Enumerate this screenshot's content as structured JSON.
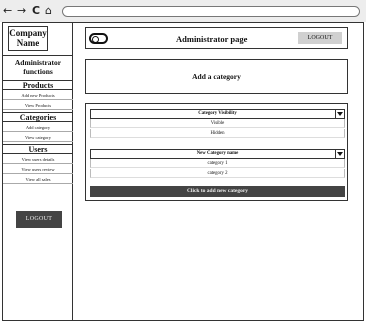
{
  "browser": {
    "back_glyph": "←",
    "forward_glyph": "→",
    "reload_glyph": "C",
    "home_glyph": "⌂"
  },
  "sidebar": {
    "company_line1": "Company",
    "company_line2": "Name",
    "functions_line1": "Administrator",
    "functions_line2": "functions",
    "sections": [
      {
        "heading": "Products",
        "items": [
          "Add new Products",
          "View Products"
        ]
      },
      {
        "heading": "Categories",
        "items": [
          "Add category",
          "View category"
        ]
      },
      {
        "heading": "Users",
        "items": [
          "View users details",
          "View users review",
          "View all sales"
        ]
      }
    ],
    "logout_label": "LOGOUT"
  },
  "header": {
    "toggle_icon": "toggle-icon",
    "title": "Administrator page",
    "logout_label": "LOGOUT"
  },
  "add_category": {
    "heading": "Add a category"
  },
  "form": {
    "visibility_select": {
      "label": "Category Visibility",
      "options": [
        "Visible",
        "Hidden"
      ]
    },
    "name_select": {
      "label": "New Category name",
      "options": [
        "category 1",
        "category 2"
      ]
    },
    "submit_label": "Click to add new category"
  },
  "colors": {
    "dark_button": "#444444",
    "light_button": "#d0d0d0",
    "chrome": "#ededed"
  }
}
